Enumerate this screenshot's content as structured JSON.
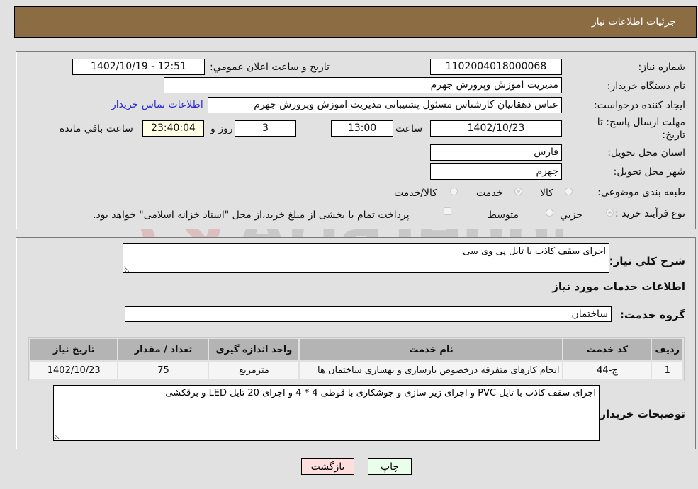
{
  "header": {
    "title": "جزئیات اطلاعات نیاز"
  },
  "details": {
    "need_number": {
      "label": "شماره نیاز:",
      "value": "1102004018000068"
    },
    "announce_datetime": {
      "label": "تاریخ و ساعت اعلان عمومي:",
      "value": "1402/10/19 - 12:51"
    },
    "buyer_org": {
      "label": "نام دستگاه خریدار:",
      "value": "مدیریت اموزش وپرورش جهرم"
    },
    "requester": {
      "label": "ایجاد کننده درخواست:",
      "value": "عباس دهقانیان کارشناس مسئول پشتیبانی مدیریت اموزش وپرورش جهرم"
    },
    "buyer_contact_link": "اطلاعات تماس خریدار",
    "deadline": {
      "label": "مهلت ارسال پاسخ: تا تاریخ:",
      "date": "1402/10/23",
      "time_label": "ساعت",
      "time": "13:00",
      "days": "3",
      "days_label": "روز و",
      "remaining": "23:40:04",
      "remaining_label": "ساعت باقي مانده"
    },
    "province": {
      "label": "استان محل تحویل:",
      "value": "فارس"
    },
    "city": {
      "label": "شهر محل تحویل:",
      "value": "جهرم"
    },
    "category": {
      "label": "طبقه بندی موضوعی:",
      "options": [
        "کالا",
        "خدمت",
        "کالا/خدمت"
      ],
      "selected": "خدمت"
    },
    "purchase_type": {
      "label": "نوع فرآیند خرید :",
      "options": [
        "جزيي",
        "متوسط"
      ],
      "selected": "جزيي",
      "treasury_note": "پرداخت تمام یا بخشی از مبلغ خرید،از محل \"اسناد خزانه اسلامی\" خواهد بود."
    }
  },
  "description": {
    "label": "شرح کلي نیاز:",
    "value": "اجرای سقف کاذب با تایل پی وی سی"
  },
  "services": {
    "section_title": "اطلاعات خدمات مورد نیاز",
    "group_label": "گروه خدمت:",
    "group_value": "ساختمان",
    "table": {
      "headers": [
        "ردیف",
        "کد خدمت",
        "نام خدمت",
        "واحد اندازه گیری",
        "تعداد / مقدار",
        "تاریخ نیاز"
      ],
      "rows": [
        [
          "1",
          "ج-44",
          "انجام کارهای متفرقه درخصوص بازسازی و بهسازی ساختمان ها",
          "مترمربع",
          "75",
          "1402/10/23"
        ]
      ]
    }
  },
  "buyer_notes": {
    "label": "توضیحات خریدار:",
    "value": "اجرای سقف کاذب با تایل PVC و اجرای زیر سازی و جوشکاری با قوطی 4 * 4 و اجرای 20 تایل LED و برقکشی"
  },
  "buttons": {
    "print": "چاپ",
    "back": "بازگشت"
  },
  "watermark": {
    "text": "AriaTender.neT"
  },
  "colors": {
    "header_bg": "#8b6c43",
    "link": "#2b2bd6",
    "print_bg": "#eaffea",
    "back_bg": "#ffdede"
  }
}
